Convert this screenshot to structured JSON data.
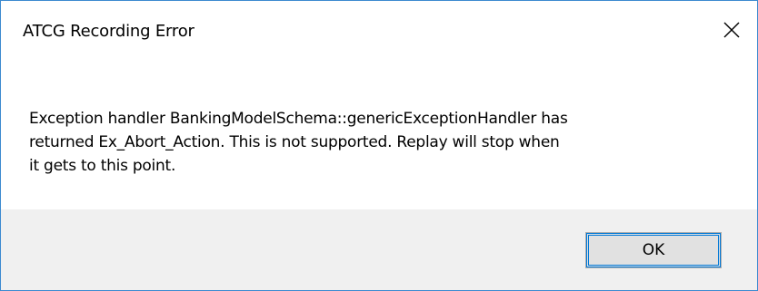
{
  "window": {
    "title": "ATCG Recording Error",
    "close_icon": "close-icon"
  },
  "message": {
    "lines": [
      "Exception handler BankingModelSchema::genericExceptionHandler has",
      "returned Ex_Abort_Action. This is not supported. Replay will stop when",
      "it gets to this point."
    ]
  },
  "buttons": {
    "ok_label": "OK"
  },
  "colors": {
    "border_accent": "#3c8ad0",
    "footer_background": "#f0f0f0",
    "button_background": "#e1e1e1",
    "button_focus": "#0078d7"
  }
}
